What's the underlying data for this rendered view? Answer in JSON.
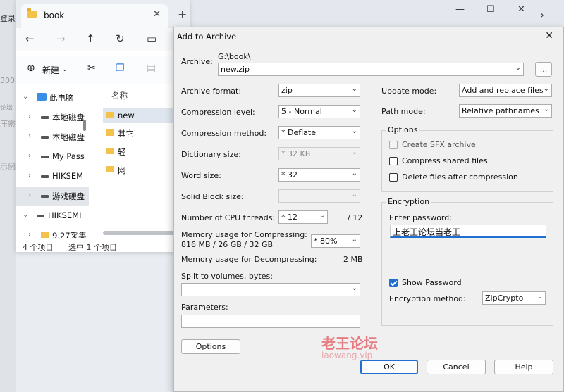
{
  "background": {
    "left_labels": [
      "登录",
      "300",
      "论坛",
      "压密",
      "示例"
    ],
    "window_controls": [
      "—",
      "☐",
      "✕"
    ]
  },
  "explorer": {
    "tab_title": "book",
    "new_label": "新建",
    "tree": [
      {
        "label": "此电脑",
        "type": "pc"
      },
      {
        "label": "本地磁盘",
        "type": "drive"
      },
      {
        "label": "本地磁盘",
        "type": "drive"
      },
      {
        "label": "My Pass",
        "type": "drive"
      },
      {
        "label": "HIKSEM",
        "type": "drive"
      },
      {
        "label": "游戏硬盘",
        "type": "drive"
      },
      {
        "label": "HIKSEMI",
        "type": "drive"
      },
      {
        "label": "9.27采集",
        "type": "folder"
      }
    ],
    "files_header": "名称",
    "files": [
      "new",
      "其它",
      "轻",
      "网"
    ],
    "status_count": "4 个项目",
    "status_selected": "选中 1 个项目"
  },
  "dialog": {
    "title": "Add to Archive",
    "archive_label": "Archive:",
    "archive_path": "G:\\book\\",
    "archive_name": "new.zip",
    "browse_label": "...",
    "archive_format_label": "Archive format:",
    "archive_format": "zip",
    "compression_level_label": "Compression level:",
    "compression_level": "5 - Normal",
    "compression_method_label": "Compression method:",
    "compression_method": "* Deflate",
    "dictionary_size_label": "Dictionary size:",
    "dictionary_size": "* 32 KB",
    "word_size_label": "Word size:",
    "word_size": "* 32",
    "solid_block_label": "Solid Block size:",
    "solid_block": "",
    "cpu_threads_label": "Number of CPU threads:",
    "cpu_threads": "* 12",
    "cpu_threads_max": "/ 12",
    "mem_compress_label": "Memory usage for Compressing:",
    "mem_compress_values": "816 MB / 26 GB / 32 GB",
    "mem_compress_percent": "* 80%",
    "mem_decompress_label": "Memory usage for Decompressing:",
    "mem_decompress_value": "2 MB",
    "split_label": "Split to volumes, bytes:",
    "split_value": "",
    "parameters_label": "Parameters:",
    "parameters_value": "",
    "options_button": "Options",
    "update_mode_label": "Update mode:",
    "update_mode": "Add and replace files",
    "path_mode_label": "Path mode:",
    "path_mode": "Relative pathnames",
    "options_group": "Options",
    "opt_sfx": "Create SFX archive",
    "opt_shared": "Compress shared files",
    "opt_delete": "Delete files after compression",
    "encryption_group": "Encryption",
    "enter_password_label": "Enter password:",
    "password_value": "上老王论坛当老王",
    "show_password_label": "Show Password",
    "encryption_method_label": "Encryption method:",
    "encryption_method": "ZipCrypto",
    "ok_button": "OK",
    "cancel_button": "Cancel",
    "help_button": "Help"
  },
  "watermark": {
    "text": "老王论坛",
    "sub": "laowang.vip"
  }
}
